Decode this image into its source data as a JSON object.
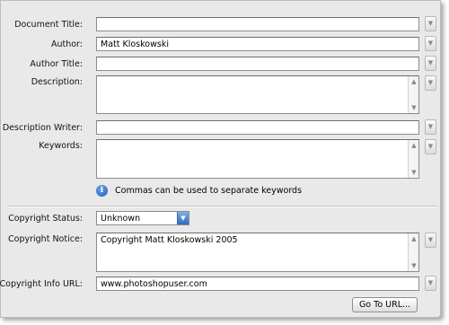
{
  "fields": {
    "document_title": {
      "label": "Document Title:",
      "value": ""
    },
    "author": {
      "label": "Author:",
      "value": "Matt Kloskowski"
    },
    "author_title": {
      "label": "Author Title:",
      "value": ""
    },
    "description": {
      "label": "Description:",
      "value": ""
    },
    "description_writer": {
      "label": "Description Writer:",
      "value": ""
    },
    "keywords": {
      "label": "Keywords:",
      "value": ""
    },
    "copyright_status": {
      "label": "Copyright Status:",
      "value": "Unknown"
    },
    "copyright_notice": {
      "label": "Copyright Notice:",
      "value": "Copyright Matt Kloskowski 2005"
    },
    "copyright_info_url": {
      "label": "Copyright Info URL:",
      "value": "www.photoshopuser.com"
    }
  },
  "info_note": "Commas can be used to separate keywords",
  "go_to_url_label": "Go To URL...",
  "icons": {
    "dropdown": "chevron-down-icon",
    "info": "info-icon",
    "scroll_up": "scroll-up-icon",
    "scroll_down": "scroll-down-icon"
  }
}
